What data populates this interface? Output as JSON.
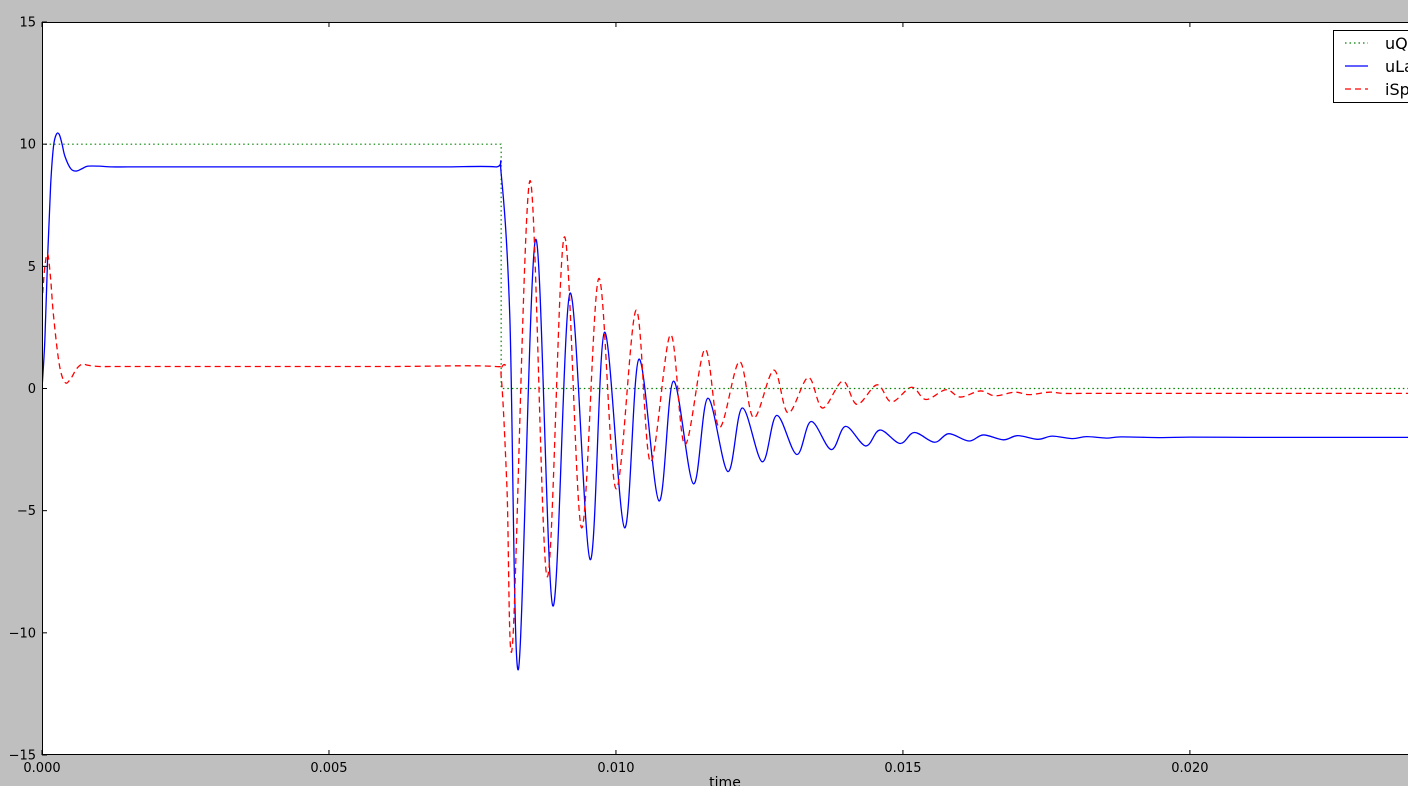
{
  "chart_data": {
    "type": "line",
    "title": "",
    "xlabel": "time",
    "ylabel": "",
    "xlim": [
      0.0,
      0.0238
    ],
    "ylim": [
      -15,
      15
    ],
    "x_ticks": [
      0.0,
      0.005,
      0.01,
      0.015,
      0.02
    ],
    "x_tick_labels": [
      "0.000",
      "0.005",
      "0.010",
      "0.015",
      "0.020"
    ],
    "y_ticks": [
      -15,
      -10,
      -5,
      0,
      5,
      10,
      15
    ],
    "y_tick_labels": [
      "−15",
      "−10",
      "−5",
      "0",
      "5",
      "10",
      "15"
    ],
    "grid": false,
    "legend_position": "top-right",
    "series": [
      {
        "name": "uQ",
        "color": "#008000",
        "style": "dotted",
        "x": [
          0.0,
          0.0,
          0.008,
          0.008,
          0.0238
        ],
        "y": [
          0.0,
          10.0,
          10.0,
          0.0,
          0.0
        ]
      },
      {
        "name": "uLa",
        "color": "#0000ff",
        "style": "solid",
        "x": [
          0.0,
          5e-05,
          0.0001,
          0.00015,
          0.0002,
          0.00025,
          0.0003,
          0.00035,
          0.0004,
          0.0005,
          0.0006,
          0.0007,
          0.0008,
          0.001,
          0.0012,
          0.0015,
          0.002,
          0.003,
          0.004,
          0.005,
          0.006,
          0.007,
          0.0079,
          0.008,
          0.00815,
          0.0083,
          0.0086,
          0.0089,
          0.0092,
          0.00955,
          0.0098,
          0.01015,
          0.0104,
          0.01075,
          0.011,
          0.01135,
          0.0116,
          0.01195,
          0.0122,
          0.01255,
          0.0128,
          0.01315,
          0.0134,
          0.01375,
          0.014,
          0.01435,
          0.0146,
          0.01495,
          0.0152,
          0.01555,
          0.0158,
          0.01615,
          0.0164,
          0.01675,
          0.017,
          0.01735,
          0.0176,
          0.01795,
          0.0182,
          0.01855,
          0.0188,
          0.0195,
          0.02,
          0.021,
          0.022,
          0.0238
        ],
        "y": [
          0.0,
          2.0,
          5.5,
          8.3,
          9.9,
          10.4,
          10.4,
          10.0,
          9.5,
          9.0,
          8.9,
          9.0,
          9.1,
          9.1,
          9.07,
          9.07,
          9.07,
          9.07,
          9.07,
          9.07,
          9.07,
          9.07,
          9.07,
          8.8,
          3.0,
          -11.5,
          6.1,
          -8.9,
          3.9,
          -7.0,
          2.3,
          -5.7,
          1.2,
          -4.6,
          0.3,
          -3.9,
          -0.4,
          -3.4,
          -0.8,
          -3.0,
          -1.1,
          -2.7,
          -1.35,
          -2.5,
          -1.55,
          -2.35,
          -1.7,
          -2.25,
          -1.8,
          -2.2,
          -1.85,
          -2.15,
          -1.9,
          -2.1,
          -1.93,
          -2.08,
          -1.95,
          -2.05,
          -1.97,
          -2.03,
          -1.98,
          -2.01,
          -1.99,
          -2.0,
          -2.0,
          -2.0
        ]
      },
      {
        "name": "iSp",
        "color": "#ff0000",
        "style": "dashed",
        "x": [
          0.0,
          5e-05,
          0.0001,
          0.00015,
          0.0002,
          0.0003,
          0.0004,
          0.0005,
          0.0006,
          0.0007,
          0.0008,
          0.001,
          0.0012,
          0.0015,
          0.002,
          0.004,
          0.006,
          0.0079,
          0.008,
          0.0081,
          0.0082,
          0.0085,
          0.0088,
          0.0091,
          0.0094,
          0.0097,
          0.01,
          0.01035,
          0.0106,
          0.01095,
          0.0112,
          0.01155,
          0.0118,
          0.01215,
          0.0124,
          0.01275,
          0.013,
          0.01335,
          0.0136,
          0.01395,
          0.0142,
          0.01455,
          0.0148,
          0.01515,
          0.0154,
          0.01575,
          0.016,
          0.01635,
          0.0166,
          0.01695,
          0.0172,
          0.01755,
          0.0178,
          0.0182,
          0.0187,
          0.0195,
          0.0205,
          0.022,
          0.0238
        ],
        "y": [
          3.5,
          5.0,
          5.5,
          4.5,
          3.0,
          1.0,
          0.25,
          0.4,
          0.8,
          1.0,
          0.95,
          0.9,
          0.9,
          0.9,
          0.9,
          0.9,
          0.9,
          0.9,
          0.5,
          -4.0,
          -10.4,
          8.5,
          -7.7,
          6.2,
          -5.7,
          4.5,
          -4.1,
          3.2,
          -3.0,
          2.2,
          -2.3,
          1.6,
          -1.6,
          1.1,
          -1.2,
          0.75,
          -1.0,
          0.45,
          -0.8,
          0.3,
          -0.65,
          0.15,
          -0.55,
          0.05,
          -0.45,
          -0.05,
          -0.35,
          -0.1,
          -0.3,
          -0.15,
          -0.25,
          -0.15,
          -0.2,
          -0.2,
          -0.2,
          -0.2,
          -0.2,
          -0.2,
          -0.2
        ]
      }
    ]
  }
}
